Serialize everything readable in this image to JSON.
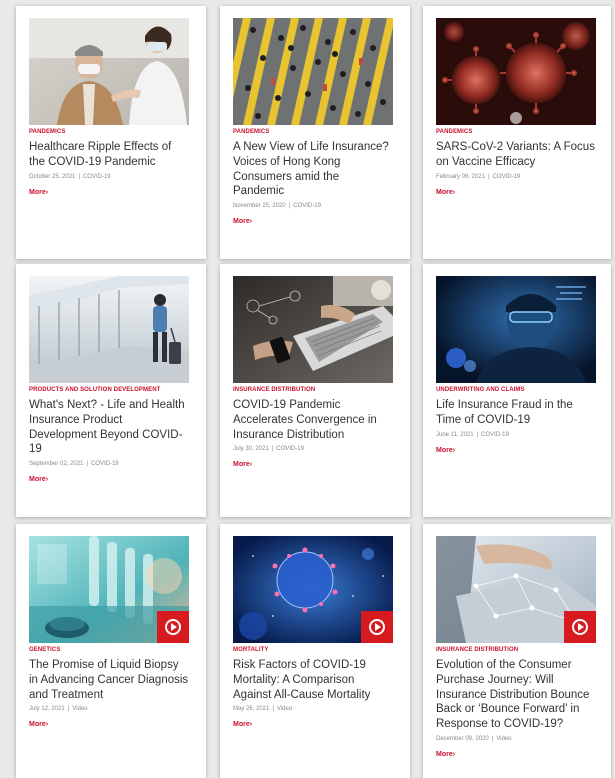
{
  "articles": [
    {
      "category": "PANDEMICS",
      "title": "Healthcare Ripple Effects of the COVID-19 Pandemic",
      "date": "October 25, 2021",
      "tag": "COVID-19",
      "more": "More",
      "video": false,
      "image": "doctor-patient-masks"
    },
    {
      "category": "PANDEMICS",
      "title": "A New View of Life Insurance? Voices of Hong Kong Consumers amid the Pandemic",
      "date": "November 25, 2020",
      "tag": "COVID-19",
      "more": "More",
      "video": false,
      "image": "crowd-crosswalk"
    },
    {
      "category": "PANDEMICS",
      "title": "SARS-CoV-2 Variants: A Focus on Vaccine Efficacy",
      "date": "February 09, 2021",
      "tag": "COVID-19",
      "more": "More",
      "video": false,
      "image": "red-virus-particles"
    },
    {
      "category": "PRODUCTS AND SOLUTION DEVELOPMENT",
      "title": "What's Next? - Life and Health Insurance Product Development Beyond COVID-19",
      "date": "September 02, 2021",
      "tag": "COVID-19",
      "more": "More",
      "video": false,
      "image": "traveler-airport"
    },
    {
      "category": "INSURANCE DISTRIBUTION",
      "title": "COVID-19 Pandemic Accelerates Convergence in Insurance Distribution",
      "date": "July 30, 2021",
      "tag": "COVID-19",
      "more": "More",
      "video": false,
      "image": "laptop-phone"
    },
    {
      "category": "UNDERWRITING AND CLAIMS",
      "title": "Life Insurance Fraud in the Time of COVID-19",
      "date": "June 11, 2021",
      "tag": "COVID-19",
      "more": "More",
      "video": false,
      "image": "man-blue-light"
    },
    {
      "category": "GENETICS",
      "title": "The Promise of Liquid Biopsy in Advancing Cancer Diagnosis and Treatment",
      "date": "July 12, 2021",
      "tag": "Video",
      "more": "More",
      "video": true,
      "image": "lab-test-tubes"
    },
    {
      "category": "MORTALITY",
      "title": "Risk Factors of COVID-19 Mortality: A Comparison Against All-Cause Mortality",
      "date": "May 26, 2021",
      "tag": "Video",
      "more": "More",
      "video": true,
      "image": "blue-virus"
    },
    {
      "category": "INSURANCE DISTRIBUTION",
      "title": "Evolution of the Consumer Purchase Journey: Will Insurance Distribution Bounce Back or ‘Bounce Forward’ in Response to COVID-19?",
      "date": "December 09, 2020",
      "tag": "Video",
      "more": "More",
      "video": true,
      "image": "hand-network"
    }
  ],
  "colors": {
    "accent": "#c8102e",
    "title": "#333333",
    "meta": "#888888",
    "play": "#d71920"
  }
}
